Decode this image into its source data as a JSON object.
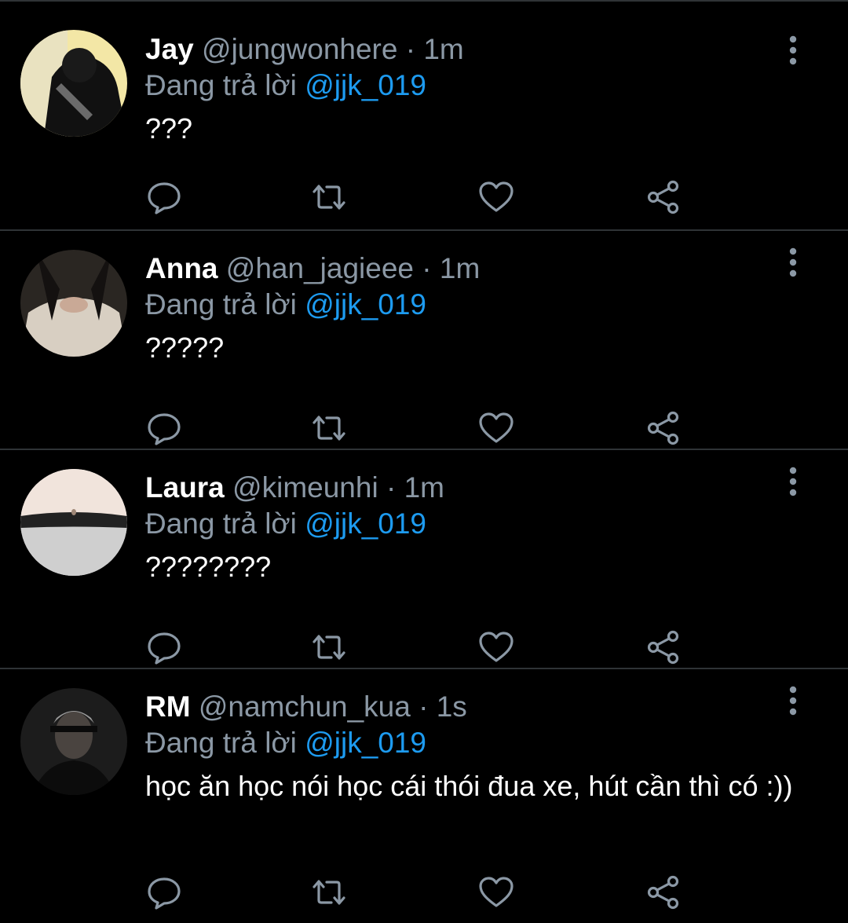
{
  "colors": {
    "background": "#000000",
    "divider": "#2f3336",
    "secondary_text": "#8b98a5",
    "mention": "#1d9bf0",
    "primary_text": "#ffffff"
  },
  "tweets": [
    {
      "name": "Jay",
      "handle": "@jungwonhere",
      "separator": "·",
      "time": "1m",
      "replying_label": "Đang trả lời",
      "reply_to": "@jjk_019",
      "text": "???"
    },
    {
      "name": "Anna",
      "handle": "@han_jagieee",
      "separator": "·",
      "time": "1m",
      "replying_label": "Đang trả lời",
      "reply_to": "@jjk_019",
      "text": "?????"
    },
    {
      "name": "Laura",
      "handle": "@kimeunhi",
      "separator": "·",
      "time": "1m",
      "replying_label": "Đang trả lời",
      "reply_to": "@jjk_019",
      "text": "????????"
    },
    {
      "name": "RM",
      "handle": "@namchun_kua",
      "separator": "·",
      "time": "1s",
      "replying_label": "Đang trả lời",
      "reply_to": "@jjk_019",
      "text": "học ăn học nói học cái thói đua xe, hút cần thì có :))"
    }
  ],
  "icons": {
    "more": "more-vertical-icon",
    "reply": "reply-bubble-icon",
    "retweet": "retweet-icon",
    "like": "heart-icon",
    "share": "share-icon"
  }
}
